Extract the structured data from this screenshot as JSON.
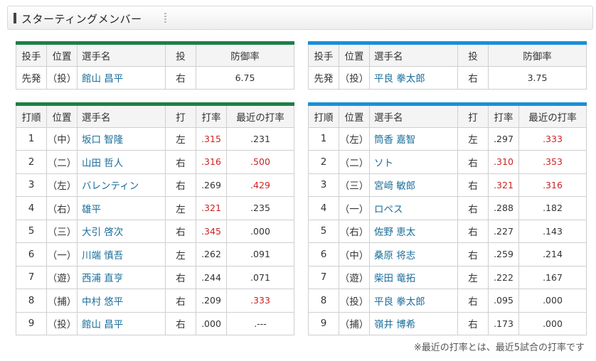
{
  "header": {
    "title": "スターティングメンバー"
  },
  "pitcher_headers": [
    "投手",
    "位置",
    "選手名",
    "投",
    "防御率"
  ],
  "batter_headers": [
    "打順",
    "位置",
    "選手名",
    "打",
    "打率",
    "最近の打率"
  ],
  "left": {
    "pitcher": {
      "role": "先発",
      "pos": "（投）",
      "name": "館山 昌平",
      "hand": "右",
      "era": "6.75"
    },
    "batters": [
      {
        "order": "1",
        "pos": "（中）",
        "name": "坂口 智隆",
        "hand": "左",
        "avg": ".315",
        "recent": ".231",
        "avg_red": true,
        "recent_red": false
      },
      {
        "order": "2",
        "pos": "（二）",
        "name": "山田 哲人",
        "hand": "右",
        "avg": ".316",
        "recent": ".500",
        "avg_red": true,
        "recent_red": true
      },
      {
        "order": "3",
        "pos": "（左）",
        "name": "バレンティン",
        "hand": "右",
        "avg": ".269",
        "recent": ".429",
        "avg_red": false,
        "recent_red": true
      },
      {
        "order": "4",
        "pos": "（右）",
        "name": "雄平",
        "hand": "左",
        "avg": ".321",
        "recent": ".235",
        "avg_red": true,
        "recent_red": false
      },
      {
        "order": "5",
        "pos": "（三）",
        "name": "大引 啓次",
        "hand": "右",
        "avg": ".345",
        "recent": ".000",
        "avg_red": true,
        "recent_red": false
      },
      {
        "order": "6",
        "pos": "（一）",
        "name": "川端 慎吾",
        "hand": "左",
        "avg": ".262",
        "recent": ".091",
        "avg_red": false,
        "recent_red": false
      },
      {
        "order": "7",
        "pos": "（遊）",
        "name": "西浦 直亨",
        "hand": "右",
        "avg": ".244",
        "recent": ".071",
        "avg_red": false,
        "recent_red": false
      },
      {
        "order": "8",
        "pos": "（捕）",
        "name": "中村 悠平",
        "hand": "右",
        "avg": ".209",
        "recent": ".333",
        "avg_red": false,
        "recent_red": true
      },
      {
        "order": "9",
        "pos": "（投）",
        "name": "館山 昌平",
        "hand": "右",
        "avg": ".000",
        "recent": ".---",
        "avg_red": false,
        "recent_red": false
      }
    ]
  },
  "right": {
    "pitcher": {
      "role": "先発",
      "pos": "（投）",
      "name": "平良 拳太郎",
      "hand": "右",
      "era": "3.75"
    },
    "batters": [
      {
        "order": "1",
        "pos": "（左）",
        "name": "筒香 嘉智",
        "hand": "左",
        "avg": ".297",
        "recent": ".333",
        "avg_red": false,
        "recent_red": true
      },
      {
        "order": "2",
        "pos": "（二）",
        "name": "ソト",
        "hand": "右",
        "avg": ".310",
        "recent": ".353",
        "avg_red": true,
        "recent_red": true
      },
      {
        "order": "3",
        "pos": "（三）",
        "name": "宮﨑 敏郎",
        "hand": "右",
        "avg": ".321",
        "recent": ".316",
        "avg_red": true,
        "recent_red": true
      },
      {
        "order": "4",
        "pos": "（一）",
        "name": "ロペス",
        "hand": "右",
        "avg": ".288",
        "recent": ".182",
        "avg_red": false,
        "recent_red": false
      },
      {
        "order": "5",
        "pos": "（右）",
        "name": "佐野 恵太",
        "hand": "右",
        "avg": ".227",
        "recent": ".143",
        "avg_red": false,
        "recent_red": false
      },
      {
        "order": "6",
        "pos": "（中）",
        "name": "桑原 将志",
        "hand": "右",
        "avg": ".259",
        "recent": ".214",
        "avg_red": false,
        "recent_red": false
      },
      {
        "order": "7",
        "pos": "（遊）",
        "name": "柴田 竜拓",
        "hand": "左",
        "avg": ".222",
        "recent": ".167",
        "avg_red": false,
        "recent_red": false
      },
      {
        "order": "8",
        "pos": "（投）",
        "name": "平良 拳太郎",
        "hand": "右",
        "avg": ".095",
        "recent": ".000",
        "avg_red": false,
        "recent_red": false
      },
      {
        "order": "9",
        "pos": "（捕）",
        "name": "嶺井 博希",
        "hand": "右",
        "avg": ".173",
        "recent": ".000",
        "avg_red": false,
        "recent_red": false
      }
    ]
  },
  "colors": {
    "home": "#1f7f46",
    "away": "#1a8fd8",
    "highlight": "#cc2222",
    "link": "#1a6e9a"
  },
  "note": "※最近の打率とは、最近5試合の打率です"
}
